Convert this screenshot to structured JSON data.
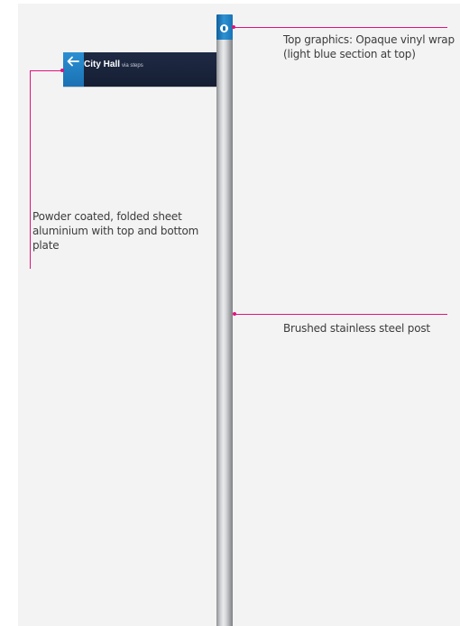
{
  "sign": {
    "destination": "City Hall",
    "subtitle": "via steps",
    "end_icon": "arrow-left-icon",
    "post_top_icon": "info-icon"
  },
  "annotations": {
    "top_graphics": "Top graphics: Opaque vinyl wrap (light blue section at top)",
    "sign_material": "Powder coated, folded sheet aluminium with top and bottom plate",
    "post": "Brushed stainless steel post"
  },
  "colors": {
    "callout": "#e0137c",
    "sign_body": "#151e33",
    "sign_accent": "#1f7fc3",
    "post": "#c8cacd"
  }
}
